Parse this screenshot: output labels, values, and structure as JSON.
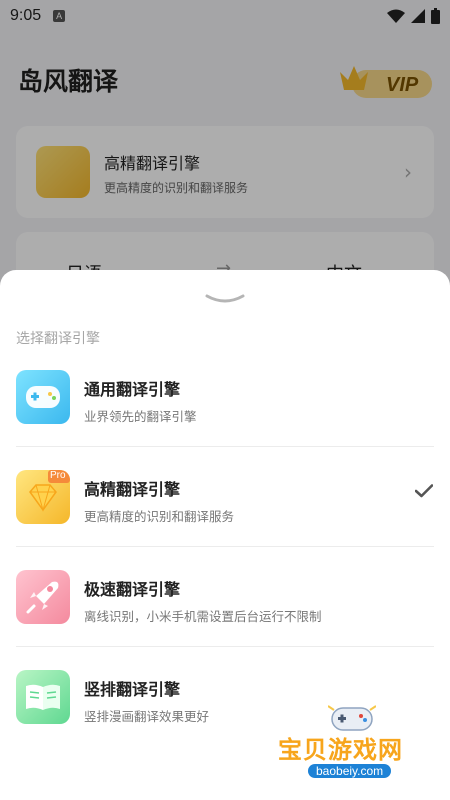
{
  "status_bar": {
    "time": "9:05",
    "notif": "A"
  },
  "header": {
    "title": "岛风翻译",
    "vip_label": "VIP"
  },
  "current_engine_card": {
    "title": "高精翻译引擎",
    "subtitle": "更高精度的识别和翻译服务"
  },
  "language_bar": {
    "source": "日语 ▾",
    "arrow": "→",
    "target": "中文 ▾"
  },
  "sheet": {
    "title": "选择翻译引擎",
    "engines": [
      {
        "name": "通用翻译引擎",
        "desc": "业界领先的翻译引擎",
        "icon": "gamepad-icon",
        "selected": false
      },
      {
        "name": "高精翻译引擎",
        "desc": "更高精度的识别和翻译服务",
        "icon": "diamond-icon",
        "badge": "Pro",
        "selected": true
      },
      {
        "name": "极速翻译引擎",
        "desc": "离线识别，小米手机需设置后台运行不限制",
        "icon": "rocket-icon",
        "selected": false
      },
      {
        "name": "竖排翻译引擎",
        "desc": "竖排漫画翻译效果更好",
        "icon": "book-icon",
        "selected": false
      }
    ]
  },
  "watermark": {
    "text": "宝贝游戏网",
    "url": "baobeiy.com"
  },
  "colors": {
    "accent_gold": "#f4b82c",
    "check": "#555555",
    "muted_text": "#777777"
  }
}
